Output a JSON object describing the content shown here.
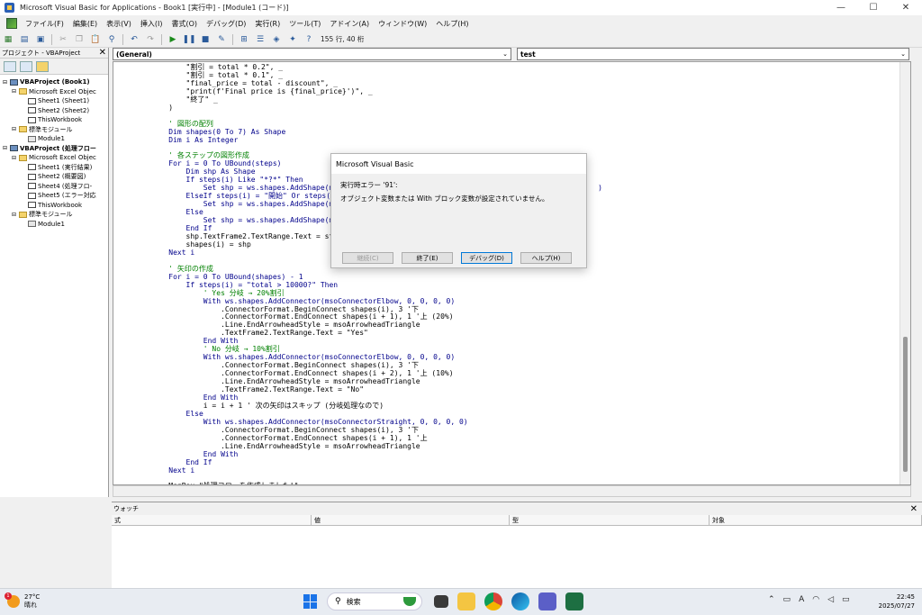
{
  "window": {
    "title": "Microsoft Visual Basic for Applications - Book1 [実行中] - [Module1 (コード)]",
    "minimize": "—",
    "maximize": "☐",
    "close": "✕"
  },
  "menu": [
    "ファイル(F)",
    "編集(E)",
    "表示(V)",
    "挿入(I)",
    "書式(O)",
    "デバッグ(D)",
    "実行(R)",
    "ツール(T)",
    "アドイン(A)",
    "ウィンドウ(W)",
    "ヘルプ(H)"
  ],
  "toolbar": {
    "position": "155 行, 40 桁"
  },
  "project": {
    "title": "プロジェクト - VBAProject",
    "tree": [
      {
        "level": 0,
        "exp": "⊟",
        "icon": "vba",
        "label": "VBAProject (Book1)",
        "bold": true
      },
      {
        "level": 1,
        "exp": "⊟",
        "icon": "folder",
        "label": "Microsoft Excel Objec"
      },
      {
        "level": 2,
        "exp": "",
        "icon": "sheet",
        "label": "Sheet1 (Sheet1)"
      },
      {
        "level": 2,
        "exp": "",
        "icon": "sheet",
        "label": "Sheet2 (Sheet2)"
      },
      {
        "level": 2,
        "exp": "",
        "icon": "sheet",
        "label": "ThisWorkbook"
      },
      {
        "level": 1,
        "exp": "⊟",
        "icon": "folder",
        "label": "標準モジュール"
      },
      {
        "level": 2,
        "exp": "",
        "icon": "mod",
        "label": "Module1"
      },
      {
        "level": 0,
        "exp": "⊟",
        "icon": "vba",
        "label": "VBAProject (処理フロー",
        "bold": true
      },
      {
        "level": 1,
        "exp": "⊟",
        "icon": "folder",
        "label": "Microsoft Excel Objec"
      },
      {
        "level": 2,
        "exp": "",
        "icon": "sheet",
        "label": "Sheet1 (実行結果)"
      },
      {
        "level": 2,
        "exp": "",
        "icon": "sheet",
        "label": "Sheet2 (概要図)"
      },
      {
        "level": 2,
        "exp": "",
        "icon": "sheet",
        "label": "Sheet4 (処理フロ-"
      },
      {
        "level": 2,
        "exp": "",
        "icon": "sheet",
        "label": "Sheet5 (エラー対応"
      },
      {
        "level": 2,
        "exp": "",
        "icon": "sheet",
        "label": "ThisWorkbook"
      },
      {
        "level": 1,
        "exp": "⊟",
        "icon": "folder",
        "label": "標準モジュール"
      },
      {
        "level": 2,
        "exp": "",
        "icon": "mod",
        "label": "Module1"
      }
    ]
  },
  "combos": {
    "left": "(General)",
    "right": "test"
  },
  "code": [
    {
      "t": "        \"割引 = total * 0.2\", _",
      "c": ""
    },
    {
      "t": "        \"割引 = total * 0.1\", _",
      "c": ""
    },
    {
      "t": "        \"final_price = total - discount\", _",
      "c": ""
    },
    {
      "t": "        \"print(f'Final price is {final_price}')\", _",
      "c": ""
    },
    {
      "t": "        \"終了\" _",
      "c": ""
    },
    {
      "t": "    )",
      "c": ""
    },
    {
      "t": "",
      "c": ""
    },
    {
      "t": "    ' 図形の配列",
      "c": "cm"
    },
    {
      "t": "    Dim shapes(0 To 7) As Shape",
      "c": "kw"
    },
    {
      "t": "    Dim i As Integer",
      "c": "kw"
    },
    {
      "t": "",
      "c": ""
    },
    {
      "t": "    ' 各ステップの図形作成",
      "c": "cm"
    },
    {
      "t": "    For i = 0 To UBound(steps)",
      "c": "kw"
    },
    {
      "t": "        Dim shp As Shape",
      "c": "kw"
    },
    {
      "t": "        If steps(i) Like \"*?*\" Then",
      "c": "kw"
    },
    {
      "t": "            Set shp = ws.shapes.AddShape(msoSha                                                        )",
      "c": "kw"
    },
    {
      "t": "        ElseIf steps(i) = \"開始\" Or steps(i) =",
      "c": "kw"
    },
    {
      "t": "            Set shp = ws.shapes.AddShape(msoSha",
      "c": "kw"
    },
    {
      "t": "        Else",
      "c": "kw"
    },
    {
      "t": "            Set shp = ws.shapes.AddShape(msoSha",
      "c": "kw"
    },
    {
      "t": "        End If",
      "c": "kw"
    },
    {
      "t": "        shp.TextFrame2.TextRange.Text = steps(i",
      "c": ""
    },
    {
      "t": "        shapes(i) = shp",
      "c": ""
    },
    {
      "t": "    Next i",
      "c": "kw"
    },
    {
      "t": "",
      "c": ""
    },
    {
      "t": "    ' 矢印の作成",
      "c": "cm"
    },
    {
      "t": "    For i = 0 To UBound(shapes) - 1",
      "c": "kw"
    },
    {
      "t": "        If steps(i) = \"total > 10000?\" Then",
      "c": "kw"
    },
    {
      "t": "            ' Yes 分岐 → 20%割引",
      "c": "cm"
    },
    {
      "t": "            With ws.shapes.AddConnector(msoConnectorElbow, 0, 0, 0, 0)",
      "c": "kw"
    },
    {
      "t": "                .ConnectorFormat.BeginConnect shapes(i), 3 '下",
      "c": ""
    },
    {
      "t": "                .ConnectorFormat.EndConnect shapes(i + 1), 1 '上 (20%)",
      "c": ""
    },
    {
      "t": "                .Line.EndArrowheadStyle = msoArrowheadTriangle",
      "c": ""
    },
    {
      "t": "                .TextFrame2.TextRange.Text = \"Yes\"",
      "c": ""
    },
    {
      "t": "            End With",
      "c": "kw"
    },
    {
      "t": "            ' No 分岐 → 10%割引",
      "c": "cm"
    },
    {
      "t": "            With ws.shapes.AddConnector(msoConnectorElbow, 0, 0, 0, 0)",
      "c": "kw"
    },
    {
      "t": "                .ConnectorFormat.BeginConnect shapes(i), 3 '下",
      "c": ""
    },
    {
      "t": "                .ConnectorFormat.EndConnect shapes(i + 2), 1 '上 (10%)",
      "c": ""
    },
    {
      "t": "                .Line.EndArrowheadStyle = msoArrowheadTriangle",
      "c": ""
    },
    {
      "t": "                .TextFrame2.TextRange.Text = \"No\"",
      "c": ""
    },
    {
      "t": "            End With",
      "c": "kw"
    },
    {
      "t": "            i = i + 1 ' 次の矢印はスキップ (分岐処理なので)",
      "c": ""
    },
    {
      "t": "        Else",
      "c": "kw"
    },
    {
      "t": "            With ws.shapes.AddConnector(msoConnectorStraight, 0, 0, 0, 0)",
      "c": "kw"
    },
    {
      "t": "                .ConnectorFormat.BeginConnect shapes(i), 3 '下",
      "c": ""
    },
    {
      "t": "                .ConnectorFormat.EndConnect shapes(i + 1), 1 '上",
      "c": ""
    },
    {
      "t": "                .Line.EndArrowheadStyle = msoArrowheadTriangle",
      "c": ""
    },
    {
      "t": "            End With",
      "c": "kw"
    },
    {
      "t": "        End If",
      "c": "kw"
    },
    {
      "t": "    Next i",
      "c": "kw"
    },
    {
      "t": "",
      "c": ""
    },
    {
      "t": "    MsgBox \"処理フローを作成しました!\"",
      "c": ""
    }
  ],
  "dialog": {
    "title": "Microsoft Visual Basic",
    "error_line": "実行時エラー '91':",
    "message": "オブジェクト変数または With ブロック変数が設定されていません。",
    "buttons": {
      "continue": "継続(C)",
      "end": "終了(E)",
      "debug": "デバッグ(D)",
      "help": "ヘルプ(H)"
    }
  },
  "watch": {
    "title": "ウォッチ",
    "close": "✕",
    "columns": [
      "式",
      "値",
      "型",
      "対象"
    ]
  },
  "taskbar": {
    "weather_temp": "27°C",
    "weather_desc": "晴れ",
    "weather_badge": "1",
    "search_label": "検索",
    "time": "22:45",
    "date": "2025/07/27"
  }
}
